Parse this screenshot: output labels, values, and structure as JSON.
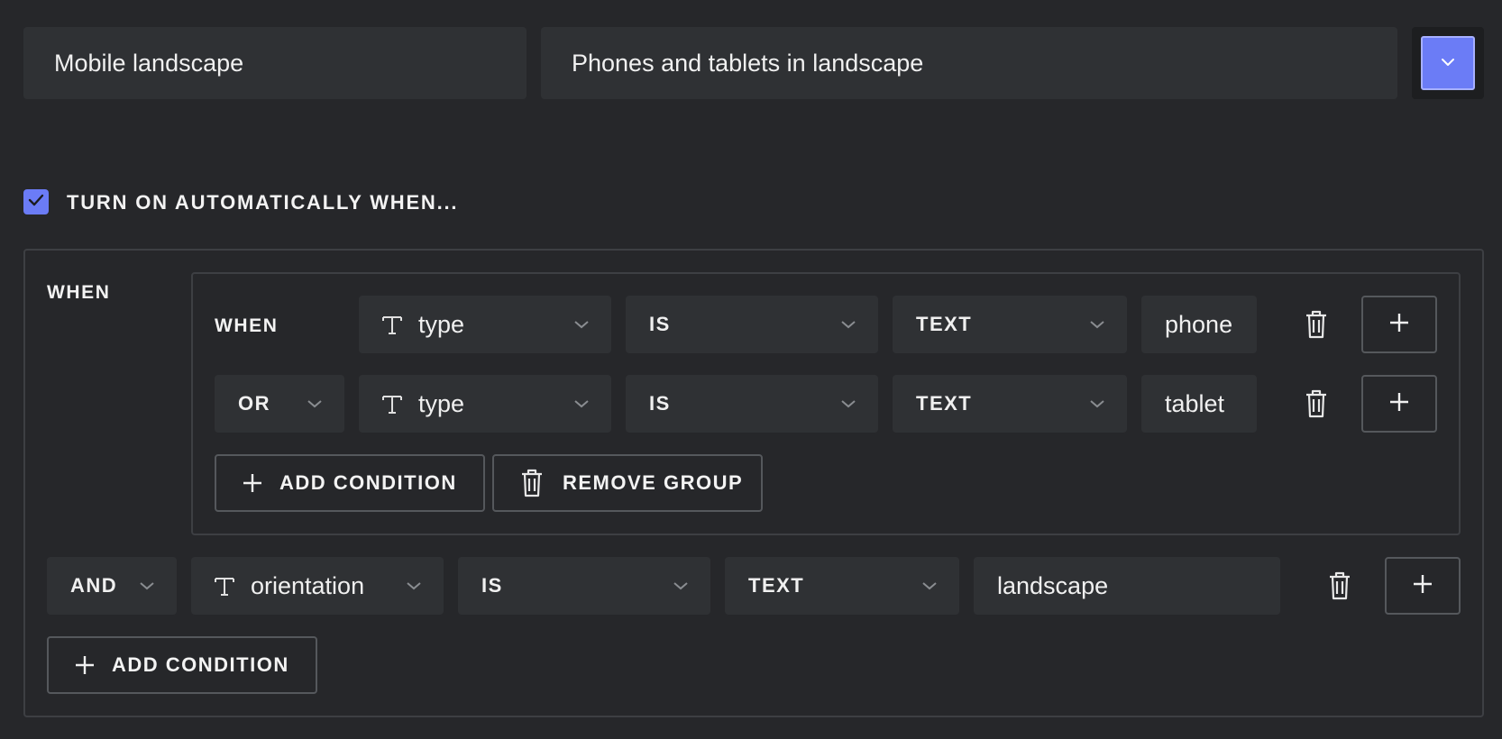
{
  "top": {
    "name_value": "Mobile landscape",
    "description_value": "Phones and tablets in landscape",
    "color_button_icon": "chevron-down-icon",
    "accent_color": "#6b7cf6"
  },
  "auto": {
    "checked": true,
    "label": "TURN ON AUTOMATICALLY WHEN..."
  },
  "outer": {
    "when_label": "WHEN",
    "group": {
      "rows": [
        {
          "connector": "WHEN",
          "field": "type",
          "operator": "IS",
          "value_type": "TEXT",
          "value": "phone"
        },
        {
          "connector": "OR",
          "field": "type",
          "operator": "IS",
          "value_type": "TEXT",
          "value": "tablet"
        }
      ],
      "add_condition_label": "ADD CONDITION",
      "remove_group_label": "REMOVE GROUP"
    },
    "row": {
      "connector": "AND",
      "field": "orientation",
      "operator": "IS",
      "value_type": "TEXT",
      "value": "landscape"
    },
    "add_condition_label": "ADD CONDITION"
  }
}
